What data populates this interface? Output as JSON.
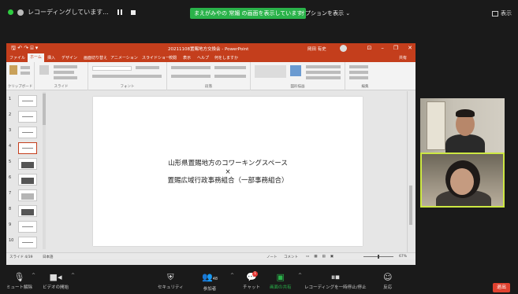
{
  "zoom_top": {
    "recording_label": "レコーディングしています...",
    "share_banner": "まえがみやの 常媚 の画面を表示しています",
    "options_label": "オプションを表示",
    "view_label": "表示"
  },
  "powerpoint": {
    "window_title": "20211108置賜地方交換会 - PowerPoint",
    "account_name": "岡田 有史",
    "tabs": [
      "ファイル",
      "ホーム",
      "挿入",
      "デザイン",
      "画面切り替え",
      "アニメーション",
      "スライドショー",
      "校閲",
      "表示",
      "ヘルプ",
      "何をしますか"
    ],
    "active_tab_index": 1,
    "share_label": "共有",
    "ribbon_groups": [
      "クリップボード",
      "スライド",
      "フォント",
      "段落",
      "図形描画",
      "編集"
    ],
    "slide_title_lines": [
      "山形県置賜地方のコワーキングスペース",
      "×",
      "置賜広域行政事務組合（一部事務組合）"
    ],
    "thumbnails": [
      {
        "num": "1",
        "style": "text"
      },
      {
        "num": "2",
        "style": "text"
      },
      {
        "num": "3",
        "style": "text"
      },
      {
        "num": "4",
        "style": "selected"
      },
      {
        "num": "5",
        "style": "dark"
      },
      {
        "num": "6",
        "style": "dark"
      },
      {
        "num": "7",
        "style": "light"
      },
      {
        "num": "8",
        "style": "dark"
      },
      {
        "num": "9",
        "style": "text"
      },
      {
        "num": "10",
        "style": "text"
      }
    ],
    "status_slide": "スライド 4/39",
    "status_lang": "日本語",
    "status_notes": "ノート",
    "status_comments": "コメント",
    "zoom_level": "67%"
  },
  "zoom_toolbar": {
    "mute": "ミュート解除",
    "video": "ビデオの開始",
    "security": "セキュリティ",
    "participants": "参加者",
    "participants_count": "48",
    "chat": "チャット",
    "chat_badge": "1",
    "share": "画面の共有",
    "share_note": "レコーディングを一時停止/停止",
    "reactions": "反応",
    "end": "退出"
  },
  "colors": {
    "ppt_accent": "#c43e1c",
    "zoom_green": "#2ab34a",
    "active_speaker": "#cde843",
    "end_red": "#e0412f"
  }
}
